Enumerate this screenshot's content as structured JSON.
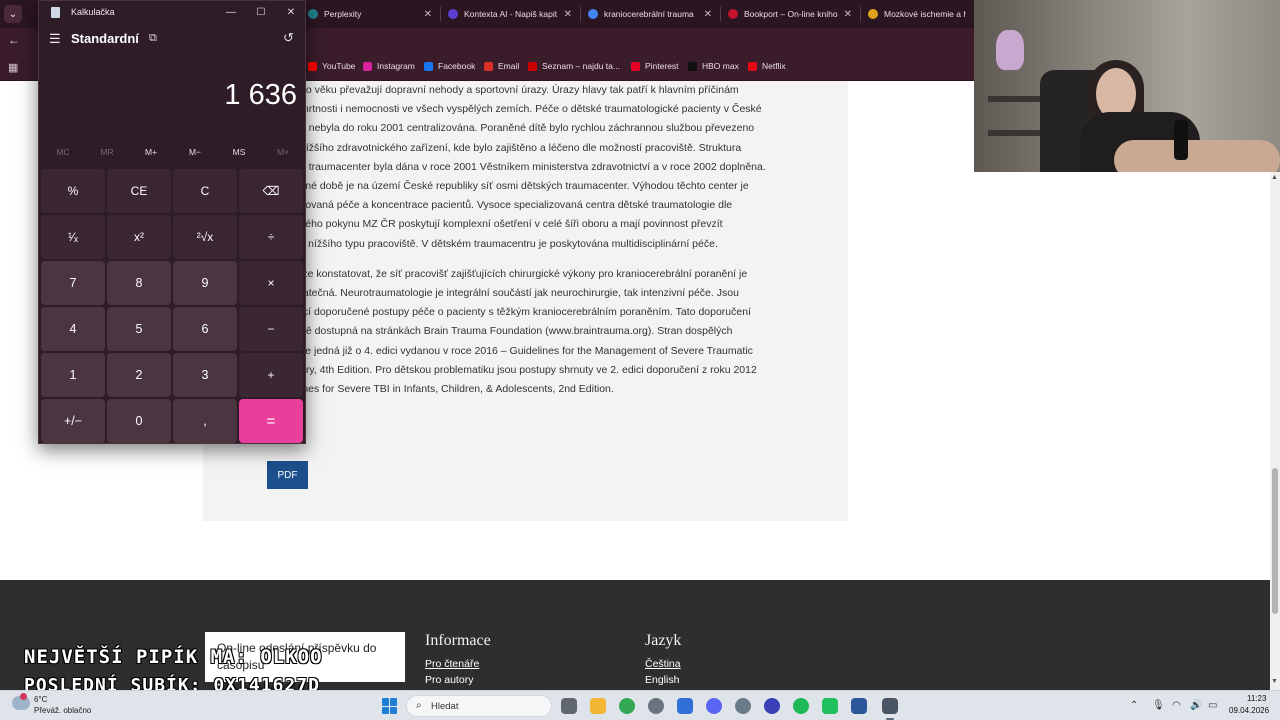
{
  "browser": {
    "tabs": [
      {
        "title": "Perplexity",
        "color": "#20808d",
        "icon": "perplexity-icon"
      },
      {
        "title": "Kontexta AI - Napiš kapit",
        "color": "#5b3fd1",
        "icon": "kontexta-icon"
      },
      {
        "title": "kraniocerebrální trauma",
        "color": "#4285f4",
        "icon": "google-icon"
      },
      {
        "title": "Bookport – On-line kniho",
        "color": "#c4122f",
        "icon": "bookport-icon"
      },
      {
        "title": "Mozkové ischemie a hem",
        "color": "#e0a21b",
        "icon": "doc-icon"
      }
    ],
    "bookmarks": [
      {
        "label": "YouTube",
        "color": "#ff0000"
      },
      {
        "label": "Instagram",
        "color": "#d6249f"
      },
      {
        "label": "Facebook",
        "color": "#1877f2"
      },
      {
        "label": "Email",
        "color": "#d93025"
      },
      {
        "label": "Seznam – najdu ta...",
        "color": "#cc0000"
      },
      {
        "label": "Pinterest",
        "color": "#e60023"
      },
      {
        "label": "HBO max",
        "color": "#111111"
      },
      {
        "label": "Netflix",
        "color": "#e50914"
      }
    ]
  },
  "article": {
    "para1": [
      "no věku převažují dopravní nehody a sportovní úrazy. Úrazy hlavy tak patří k hlavním příčinám",
      "mrtnosti i nemocnosti ve všech vyspělých zemích. Péče o dětské traumatologické pacienty v České",
      "e nebyla do roku 2001 centralizována. Poraněné dítě bylo rychlou záchrannou službou převezeno",
      "nížšího zdravotnického zařízení, kde bylo zajištěno a léčeno dle možností pracoviště. Struktura",
      "n traumacenter byla dána v roce 2001 Věstníkem ministerstva zdravotnictví a v roce 2002 doplněna.",
      "sné době je na území České republiky síť osmi dětských traumacenter. Výhodou těchto center je",
      "zovaná péče a koncentrace pacientů. Vysoce specializovaná centra dětské traumatologie dle",
      "kého pokynu MZ ČR poskytují komplexní ošetření v celé šíři oboru a mají povinnost převzít",
      "z nížšího typu pracoviště. V dětském traumacentru je poskytována multidisciplinární péče."
    ],
    "para2": [
      "lze konstatovat, že síť pracovišť zajišťujících chirurgické výkony pro kraniocerebrální poranění je",
      "tatečná. Neurotraumatologie je integrální součástí jak neurochirurgie, tak intenzivní péče. Jsou",
      "ící doporučené postupy péče o pacienty s těžkým kraniocerebrálním poraněním. Tato doporučení",
      "ně dostupná na stránkách Brain Trauma Foundation (www.braintrauma.org). Stran dospělých",
      "se jedná již o 4. edici vydanou v roce 2016 – Guidelines for the Management of Severe Traumatic",
      "ury, 4th Edition. Pro dětskou problematiku jsou postupy shrnuty ve 2. edici doporučení z roku 2012",
      "ines for Severe TBI in Infants, Children, & Adolescents, 2nd  Edition."
    ],
    "pdf_label": "PDF"
  },
  "footer": {
    "submit_text": "On-line odeslání příspěvku do časopisu",
    "info_title": "Informace",
    "info_links": [
      "Pro čtenáře",
      "Pro autory"
    ],
    "lang_title": "Jazyk",
    "lang_links": [
      "Čeština",
      "English"
    ]
  },
  "overlay": {
    "line1": "NEJVĚTŠÍ PIPÍK MA: OLKOO",
    "line2": "POSLEDNÍ SUBÍK: 0X141627D"
  },
  "calculator": {
    "window_title": "Kalkulačka",
    "mode": "Standardní",
    "display": "1 636",
    "memory": [
      {
        "label": "MC",
        "enabled": false
      },
      {
        "label": "MR",
        "enabled": false
      },
      {
        "label": "M+",
        "enabled": true
      },
      {
        "label": "M−",
        "enabled": true
      },
      {
        "label": "MS",
        "enabled": true
      },
      {
        "label": "M˅",
        "enabled": false
      }
    ],
    "keys": [
      [
        "%",
        "CE",
        "C",
        "⌫"
      ],
      [
        "¹⁄ₓ",
        "x²",
        "²√x",
        "÷"
      ],
      [
        "7",
        "8",
        "9",
        "×"
      ],
      [
        "4",
        "5",
        "6",
        "−"
      ],
      [
        "1",
        "2",
        "3",
        "+"
      ],
      [
        "+/−",
        "0",
        ",",
        "="
      ]
    ]
  },
  "taskbar": {
    "temperature": "6°C",
    "weather": "Převáž. oblačno",
    "search_placeholder": "Hledat",
    "time": "11:23",
    "date": "09.04.2026"
  }
}
